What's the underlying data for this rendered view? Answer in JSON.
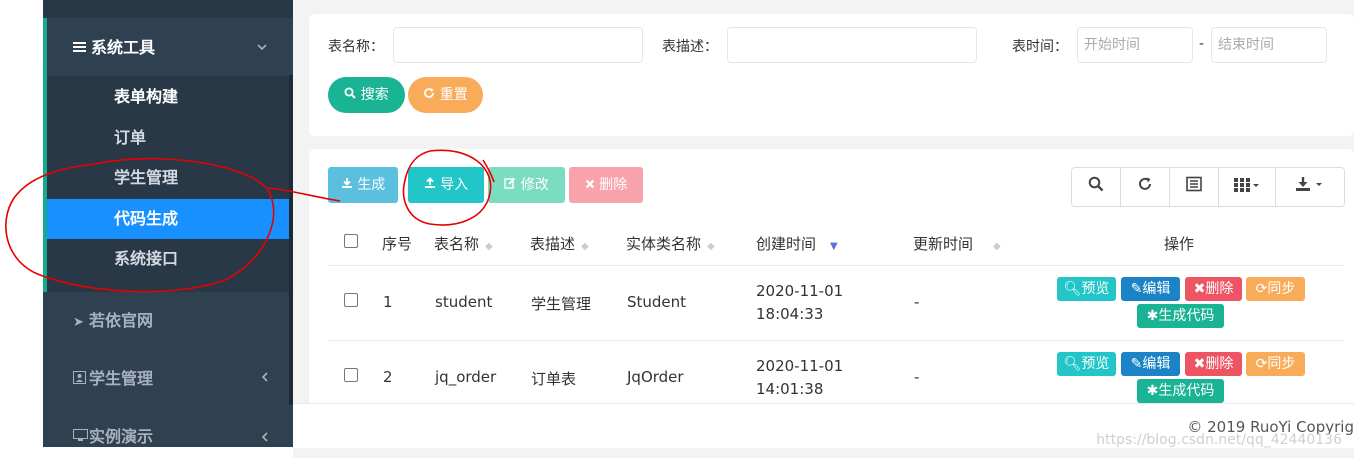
{
  "sidebar": {
    "section_title": "系统工具",
    "sub_items": [
      {
        "label": "表单构建"
      },
      {
        "label": "订单"
      },
      {
        "label": "学生管理"
      },
      {
        "label": "代码生成"
      },
      {
        "label": "系统接口"
      }
    ],
    "main_items": [
      {
        "label": "若依官网",
        "icon": "send-icon"
      },
      {
        "label": "学生管理",
        "icon": "user-card-icon"
      },
      {
        "label": "实例演示",
        "icon": "desktop-icon"
      }
    ]
  },
  "search_form": {
    "table_name_label": "表名称：",
    "table_desc_label": "表描述：",
    "table_time_label": "表时间：",
    "start_placeholder": "开始时间",
    "end_placeholder": "结束时间",
    "dash": "-",
    "search_button": "搜索",
    "reset_button": "重置"
  },
  "toolbar": {
    "generate": "生成",
    "import": "导入",
    "edit": "修改",
    "delete": "删除"
  },
  "table": {
    "headers": [
      "序号",
      "表名称",
      "表描述",
      "实体类名称",
      "创建时间",
      "更新时间",
      "操作"
    ],
    "rows": [
      {
        "index": "1",
        "table_name": "student",
        "table_desc": "学生管理",
        "class_name": "Student",
        "create_date": "2020-11-01",
        "create_time": "18:04:33",
        "update_time": "-"
      },
      {
        "index": "2",
        "table_name": "jq_order",
        "table_desc": "订单表",
        "class_name": "JqOrder",
        "create_date": "2020-11-01",
        "create_time": "14:01:38",
        "update_time": "-"
      }
    ],
    "actions": {
      "preview": "预览",
      "edit": "编辑",
      "delete": "删除",
      "sync": "同步",
      "generate": "生成代码"
    }
  },
  "footer": {
    "copyright": "© 2019 RuoYi Copyrig",
    "watermark": "https://blog.csdn.net/qq_42440136"
  },
  "colors": {
    "sidebar_bg": "#2f4050",
    "sidebar_active": "#1890ff",
    "primary_green": "#1ab394",
    "warning_orange": "#f8ac59",
    "info_blue": "#5bc0de",
    "teal": "#23c6c8",
    "danger": "#ed5565",
    "annotation_red": "#e60000"
  }
}
